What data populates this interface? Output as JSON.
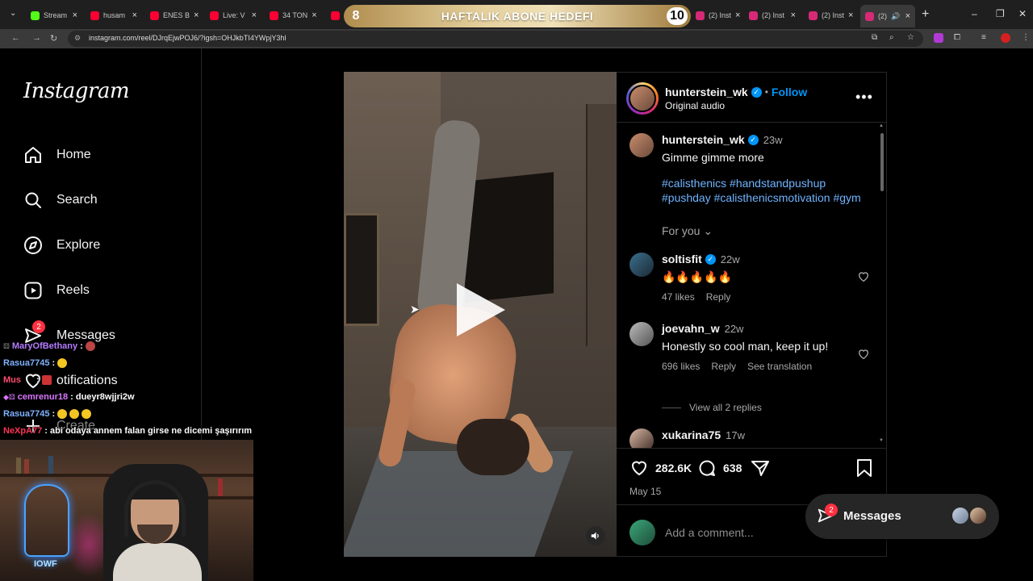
{
  "browser": {
    "tabs": [
      {
        "label": "Stream",
        "color": "#53fc18"
      },
      {
        "label": "husam",
        "color": "#ff0033"
      },
      {
        "label": "ENES B",
        "color": "#ff0033"
      },
      {
        "label": "Live: V",
        "color": "#ff0033"
      },
      {
        "label": "34 TON",
        "color": "#ff0033"
      },
      {
        "label": "(2) Inst",
        "color": "#d62976"
      },
      {
        "label": "(2) Inst",
        "color": "#d62976"
      },
      {
        "label": "(2) Inst",
        "color": "#d62976"
      },
      {
        "label": "(2) Inst",
        "color": "#d62976"
      },
      {
        "label": "(2)",
        "color": "#d62976"
      }
    ],
    "url": "instagram.com/reel/DJrqEjwPOJ6/?igsh=OHJkbTI4YWpjY3hl"
  },
  "overlay_goal": {
    "title": "HAFTALIK ABONE HEDEFI",
    "current": "8",
    "target": "10"
  },
  "instagram": {
    "logo": "Instagram",
    "nav": [
      {
        "label": "Home",
        "icon": "home-icon"
      },
      {
        "label": "Search",
        "icon": "search-icon"
      },
      {
        "label": "Explore",
        "icon": "compass-icon"
      },
      {
        "label": "Reels",
        "icon": "reels-icon"
      },
      {
        "label": "Messages",
        "icon": "messenger-icon",
        "badge": "2"
      },
      {
        "label": "otifications",
        "icon": "heart-icon"
      },
      {
        "label": "Create",
        "icon": "plus-icon"
      }
    ],
    "post": {
      "username": "hunterstein_wk",
      "follow_label": "Follow",
      "separator": "•",
      "audio": "Original audio",
      "caption_time": "23w",
      "caption": "Gimme gimme more",
      "hashtags": "#calisthenics #handstandpushup #pushday #calisthenicsmotivation #gym",
      "for_you": "For you",
      "likes": "282.6K",
      "comment_count": "638",
      "date": "May 15",
      "add_comment_placeholder": "Add a comment..."
    },
    "comments": [
      {
        "user": "soltisfit",
        "verified": true,
        "time": "22w",
        "text": "🔥🔥🔥🔥🔥",
        "likes": "47 likes",
        "reply": "Reply"
      },
      {
        "user": "joevahn_w",
        "verified": false,
        "time": "22w",
        "text": "Honestly so cool man, keep it up!",
        "likes": "696 likes",
        "reply": "Reply",
        "translate": "See translation",
        "view_replies": "View all 2 replies"
      },
      {
        "user": "xukarina75",
        "verified": false,
        "time": "17w"
      }
    ],
    "messages_widget": {
      "label": "Messages",
      "badge": "2"
    }
  },
  "chat": [
    {
      "user": "MaryOfBethany",
      "msg": ":",
      "color": "#b57cff"
    },
    {
      "user": "Rasua7745",
      "msg": ":",
      "color": "#7fb2ff"
    },
    {
      "user": "Mus",
      "msg": ":",
      "color": "#ff4d6d"
    },
    {
      "user": "cemrenur18",
      "msg": ": dueyr8wjjri2w",
      "color": "#d977ff"
    },
    {
      "user": "Rasua7745",
      "msg": ":",
      "color": "#7fb2ff"
    },
    {
      "user": "NeXpA77",
      "msg": ": abi odaya annem falan girse ne dicemi şaşırırım",
      "color": "#ff3355"
    }
  ],
  "webcam": {
    "sign_text": "IOWF"
  },
  "colors": {
    "accent": "#0095f6",
    "badge": "#ff3040",
    "background": "#000000"
  }
}
